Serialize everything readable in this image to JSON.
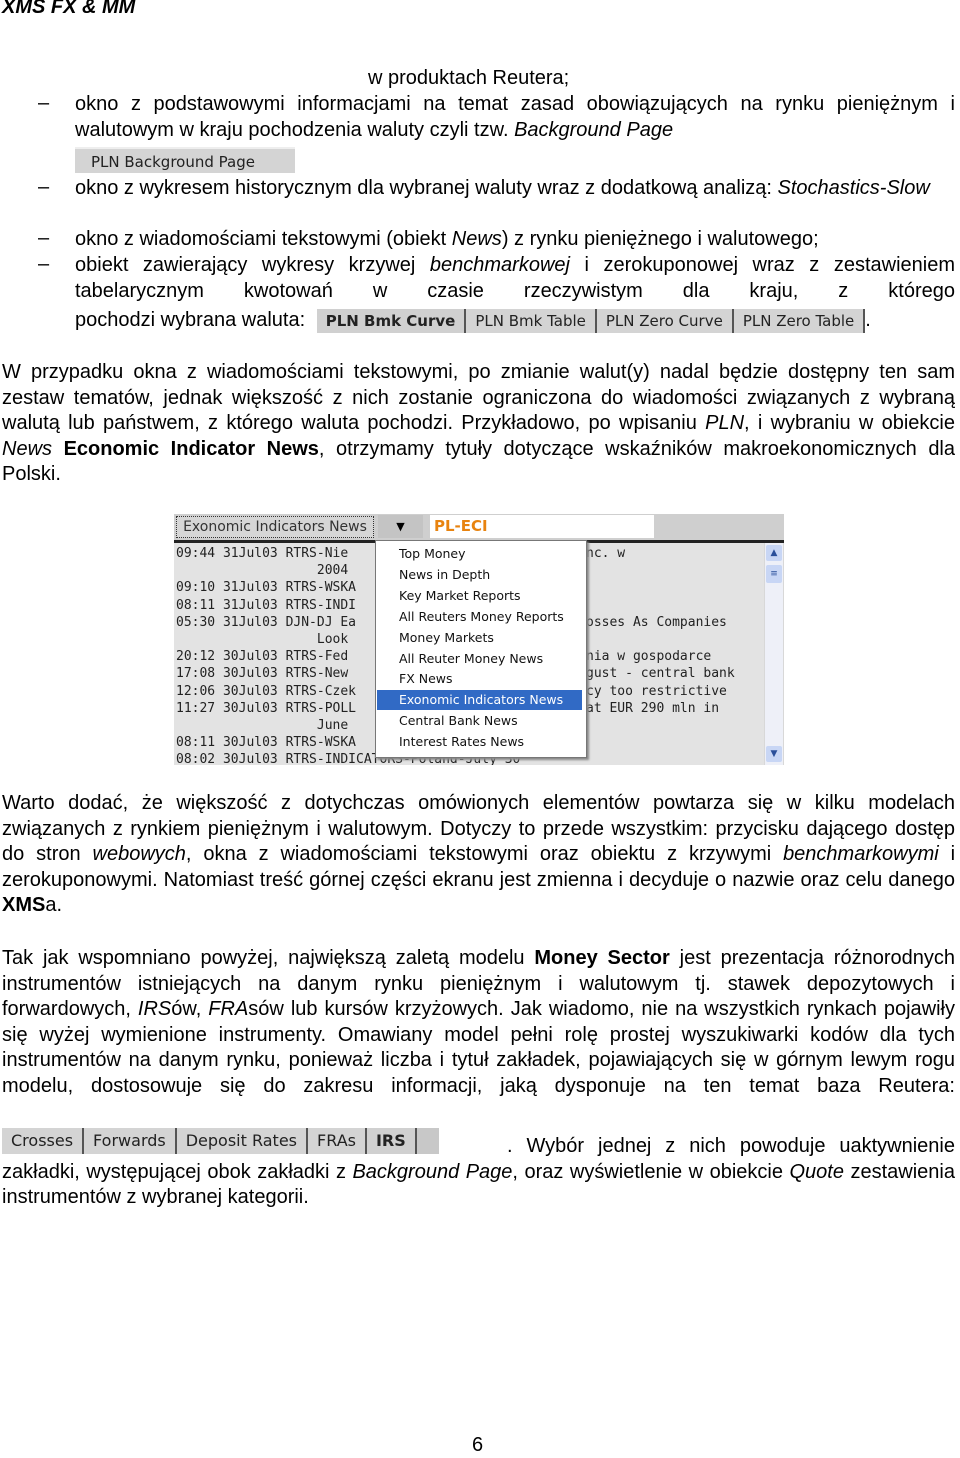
{
  "header": "XMS FX & MM",
  "intro_line": "w produktach Reutera;",
  "bullets": [
    [
      {
        "t": "okno z podstawowymi informacjami na temat zasad obowiązujących na rynku pieniężnym i walutowym w kraju pochodzenia waluty czyli tzw. "
      },
      {
        "t": "Background Page",
        "s": "i"
      }
    ],
    [
      {
        "t": "okno z wykresem historycznym dla wybranej waluty wraz z dodatkową analizą: "
      },
      {
        "t": "Stochastics-Slow",
        "s": "i"
      }
    ],
    [
      {
        "t": "okno z wiadomościami tekstowymi (obiekt "
      },
      {
        "t": "News",
        "s": "i"
      },
      {
        "t": ")  z rynku pieniężnego i walutowego;"
      }
    ],
    [
      {
        "t": "obiekt zawierający wykresy krzywej "
      },
      {
        "t": "benchmarkowej",
        "s": "i"
      },
      {
        "t": " i zerokuponowej wraz z zestawieniem tabelarycznym kwotowań w czasie rzeczywistym dla kraju, z którego"
      }
    ]
  ],
  "bullet4_tail": "pochodzi wybrana waluta:",
  "background_button": "PLN Background Page",
  "curve_tabs": [
    "PLN Bmk Curve",
    "PLN Bmk Table",
    "PLN Zero Curve",
    "PLN Zero Table"
  ],
  "paragraph1": [
    {
      "t": "W przypadku okna z wiadomościami tekstowymi, po zmianie walut(y) nadal będzie dostępny ten sam zestaw tematów, jednak większość z nich zostanie ograniczona do wiadomości związanych z wybraną walutą lub państwem, z którego waluta pochodzi. Przykładowo, po wpisaniu "
    },
    {
      "t": "PLN",
      "s": "i"
    },
    {
      "t": ", i wybraniu w obiekcie "
    },
    {
      "t": "News",
      "s": "i"
    },
    {
      "t": " "
    },
    {
      "t": "Economic Indicator News",
      "s": "b"
    },
    {
      "t": ", otrzymamy tytuły dotyczące wskaźników makroekonomicznych dla Polski."
    }
  ],
  "news_window": {
    "category_button": "Exonomic Indicators News",
    "ric": "PL-ECI",
    "rows": [
      {
        "l": "09:44 31Jul03 RTRS-Nie ",
        "r": "nc. w"
      },
      {
        "l": "                  2004",
        "r": ""
      },
      {
        "l": "09:10 31Jul03 RTRS-WSKA",
        "r": ""
      },
      {
        "l": "08:11 31Jul03 RTRS-INDI",
        "r": ""
      },
      {
        "l": "05:30 31Jul03 DJN-DJ Ea",
        "r": "osses As Companies"
      },
      {
        "l": "                  Look",
        "r": ""
      },
      {
        "l": "20:12 30Jul03 RTRS-Fed ",
        "r": "nia w gospodarce"
      },
      {
        "l": "17:08 30Jul03 RTRS-New ",
        "r": "gust - central bank"
      },
      {
        "l": "12:06 30Jul03 RTRS-Czek",
        "r": "cy too restrictive"
      },
      {
        "l": "11:27 30Jul03 RTRS-POLL",
        "r": "at EUR 290 mln in"
      },
      {
        "l": "                  June",
        "r": ""
      },
      {
        "l": "08:11 30Jul03 RTRS-WSKA",
        "r": ""
      },
      {
        "l": "08:02 30Jul03 RTRS-INDICATORS-Poland-July 30",
        "r": ""
      }
    ],
    "menu_items": [
      "Top Money",
      "News in Depth",
      "Key Market Reports",
      "All Reuters Money Reports",
      "Money Markets",
      "All Reuter Money News",
      "FX News",
      "Exonomic Indicators News",
      "Central Bank News",
      "Interest Rates News"
    ],
    "selected_item": "Exonomic Indicators News",
    "highlight_color": "#316ac5"
  },
  "paragraph2": [
    {
      "t": "Warto dodać, że większość z dotychczas omówionych elementów powtarza się w kilku modelach związanych z rynkiem pieniężnym i walutowym. Dotyczy to przede wszystkim: przycisku dającego dostęp do stron "
    },
    {
      "t": "webowych",
      "s": "i"
    },
    {
      "t": ", okna z wiadomościami tekstowymi oraz obiektu z krzywymi "
    },
    {
      "t": "benchmarkowymi",
      "s": "i"
    },
    {
      "t": " i zerokuponowymi. Natomiast treść górnej części ekranu jest zmienna i decyduje o nazwie oraz celu danego "
    },
    {
      "t": "XMS",
      "s": "b"
    },
    {
      "t": "a."
    }
  ],
  "paragraph3": [
    {
      "t": "Tak jak wspomniano powyżej, największą zaletą modelu "
    },
    {
      "t": "Money Sector",
      "s": "b"
    },
    {
      "t": " jest prezentacja różnorodnych instrumentów istniejących na danym rynku pieniężnym i walutowym tj. stawek depozytowych i forwardowych, "
    },
    {
      "t": "IRS",
      "s": "i"
    },
    {
      "t": "ów, "
    },
    {
      "t": "FRA",
      "s": "i"
    },
    {
      "t": "sów lub kursów krzyżowych. Jak wiadomo, nie na wszystkich rynkach pojawiły się wyżej wymienione instrumenty. Omawiany model pełni rolę prostej wyszukiwarki kodów dla tych instrumentów na danym rynku, ponieważ liczba i tytuł zakładek, pojawiających się w górnym lewym rogu modelu, dostosowuje się do zakresu informacji, jaką dysponuje na ten temat baza Reutera:"
    }
  ],
  "instrument_tabs": [
    "Crosses",
    "Forwards",
    "Deposit Rates",
    "FRAs",
    "IRS"
  ],
  "paragraph4": [
    {
      "t": ". Wybór jednej z nich powoduje uaktywnienie zakładki, występującej obok zakładki z "
    },
    {
      "t": "Background Page",
      "s": "i"
    },
    {
      "t": ", oraz wyświetlenie w obiekcie "
    },
    {
      "t": "Quote",
      "s": "i"
    },
    {
      "t": " zestawienia instrumentów z wybranej  kategorii."
    }
  ],
  "page_number": "6"
}
